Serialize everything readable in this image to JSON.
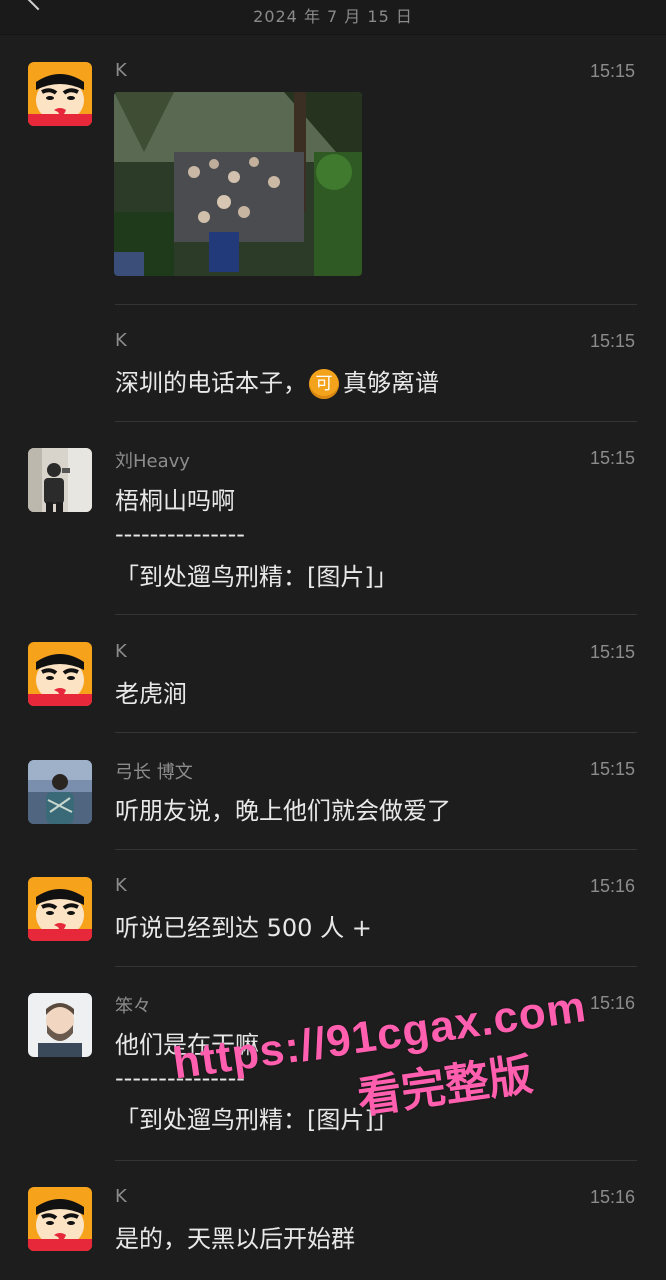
{
  "header": {
    "date": "2024 年 7 月 15 日"
  },
  "messages": [
    {
      "sender": "K",
      "time": "15:15",
      "type": "image"
    },
    {
      "sender": "K",
      "time": "15:15",
      "text_before": "深圳的电话本子，",
      "emoji": "可",
      "text_after": "真够离谱"
    },
    {
      "sender": "刘Heavy",
      "time": "15:15",
      "text": "梧桐山吗啊",
      "separator": "---------------",
      "quote": "「到处遛鸟刑精：[图片]」"
    },
    {
      "sender": "K",
      "time": "15:15",
      "text": "老虎涧"
    },
    {
      "sender": "弓长 博文",
      "time": "15:15",
      "text": "听朋友说，晚上他们就会做爱了"
    },
    {
      "sender": "K",
      "time": "15:16",
      "text": "听说已经到达 500 人 +"
    },
    {
      "sender": "笨々",
      "time": "15:16",
      "text": "他们是在干嘛",
      "separator": "---------------",
      "quote": "「到处遛鸟刑精：[图片]」"
    },
    {
      "sender": "K",
      "time": "15:16",
      "text": "是的，天黑以后开始群"
    }
  ],
  "watermark": {
    "url": "https://91cgax.com",
    "label": "看完整版"
  },
  "colors": {
    "background": "#1d1d1d",
    "text": "#e8e8e8",
    "meta": "#8c8c8c",
    "watermark": "#ff5fae"
  }
}
